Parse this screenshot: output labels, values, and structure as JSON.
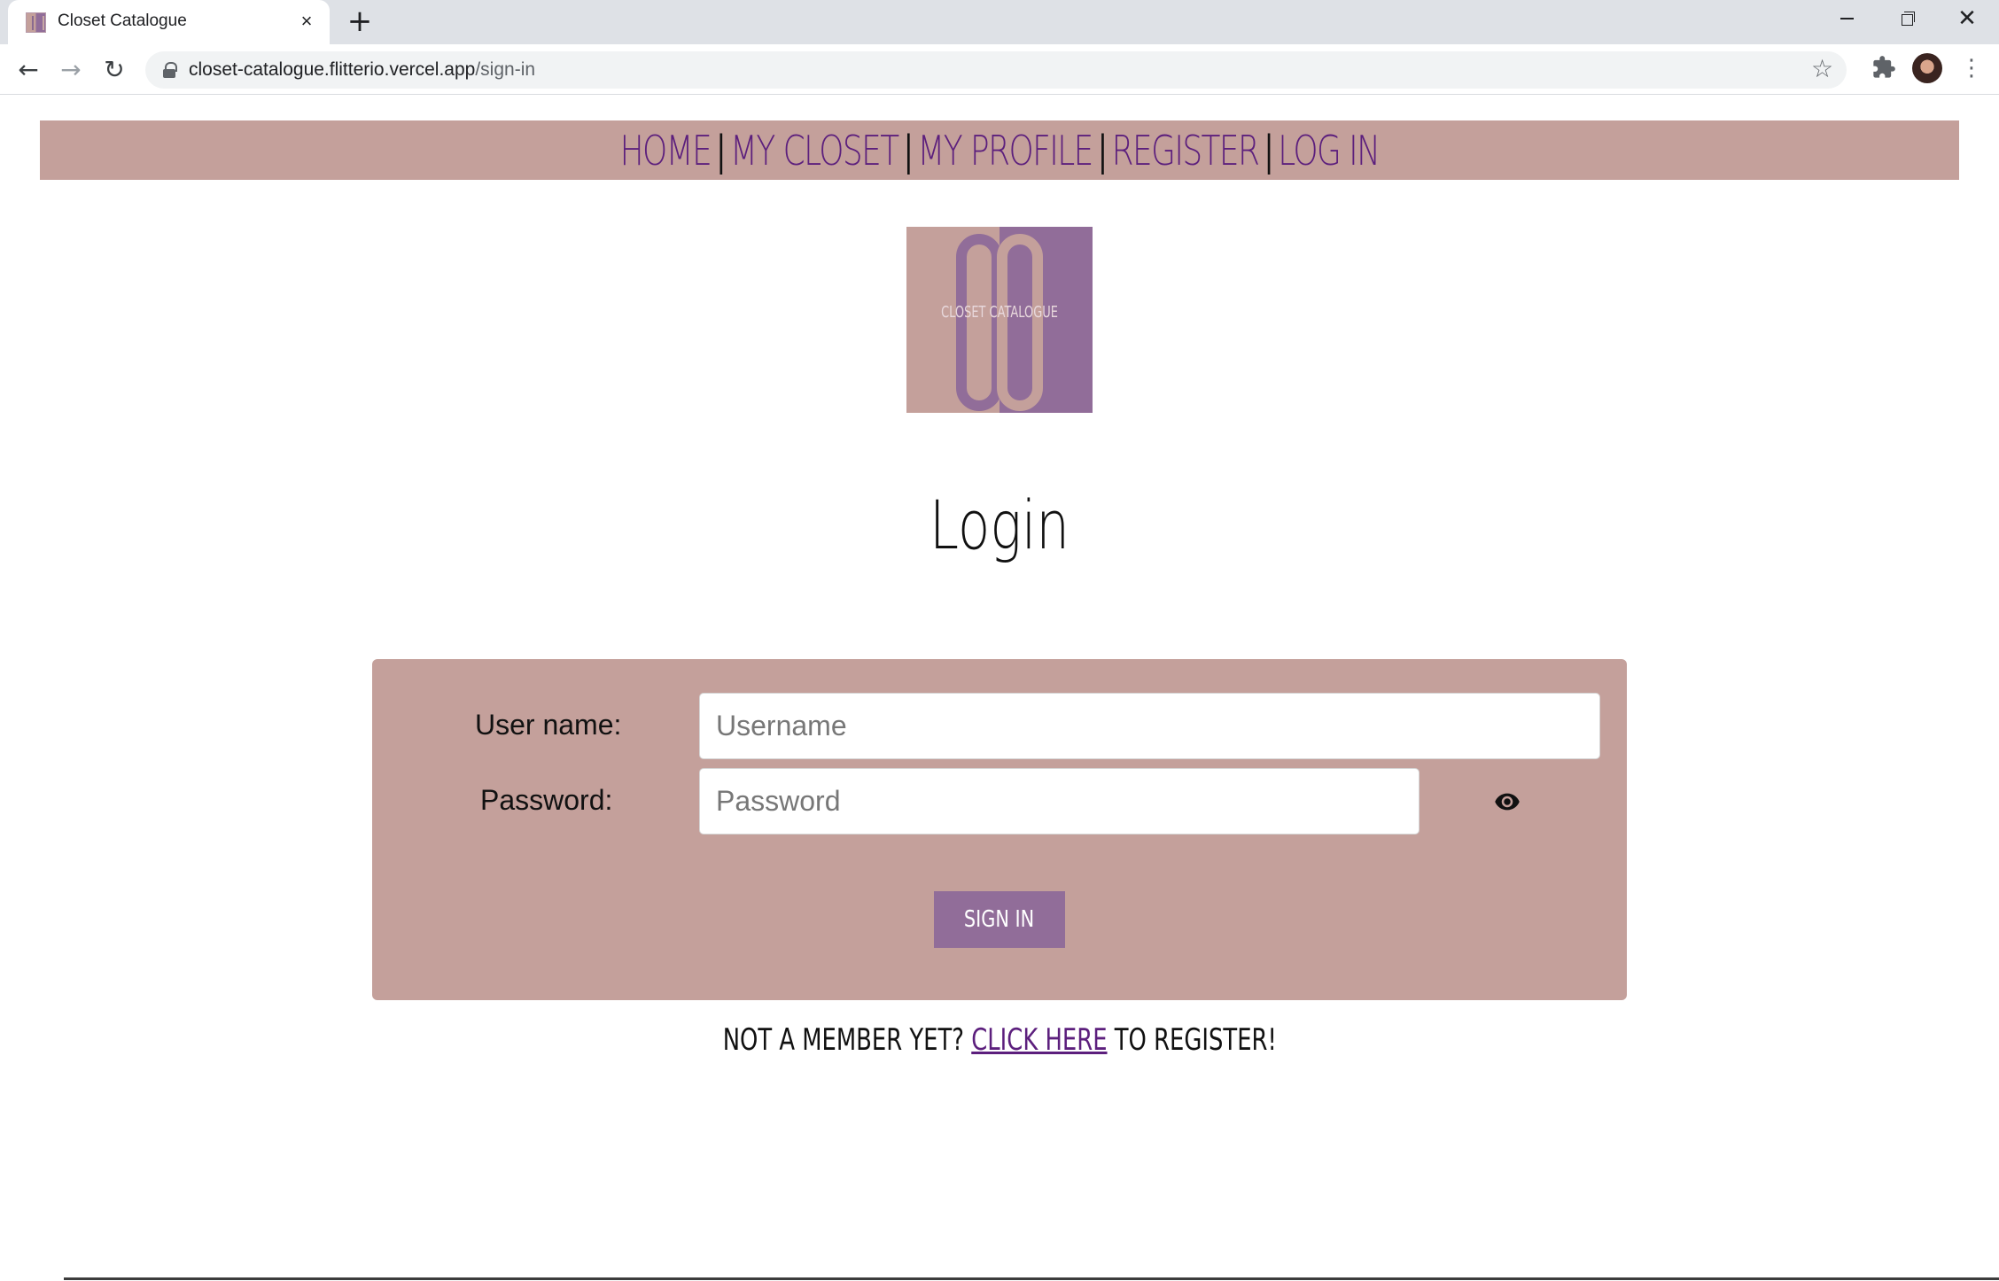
{
  "browser": {
    "tab_title": "Closet Catalogue",
    "tab_close_glyph": "×",
    "new_tab_glyph": "+",
    "url_host": "closet-catalogue.flitterio.vercel.app",
    "url_path": "/sign-in"
  },
  "nav": {
    "home": "HOME",
    "my_closet": "MY CLOSET",
    "my_profile": "MY PROFILE",
    "register": "REGISTER",
    "log_in": "LOG IN",
    "separator": "|"
  },
  "logo": {
    "text": "CLOSET CATALOGUE"
  },
  "page": {
    "title": "Login"
  },
  "form": {
    "username_label": "User name:",
    "username_placeholder": "Username",
    "password_label": "Password:",
    "password_placeholder": "Password",
    "submit_label": "SIGN IN"
  },
  "register_prompt": {
    "before": "NOT A MEMBER YET? ",
    "link": "CLICK HERE",
    "after": " TO REGISTER!"
  },
  "colors": {
    "brand_rose": "#c4a09b",
    "brand_purple": "#916d99",
    "link_purple": "#5c1f7d"
  }
}
